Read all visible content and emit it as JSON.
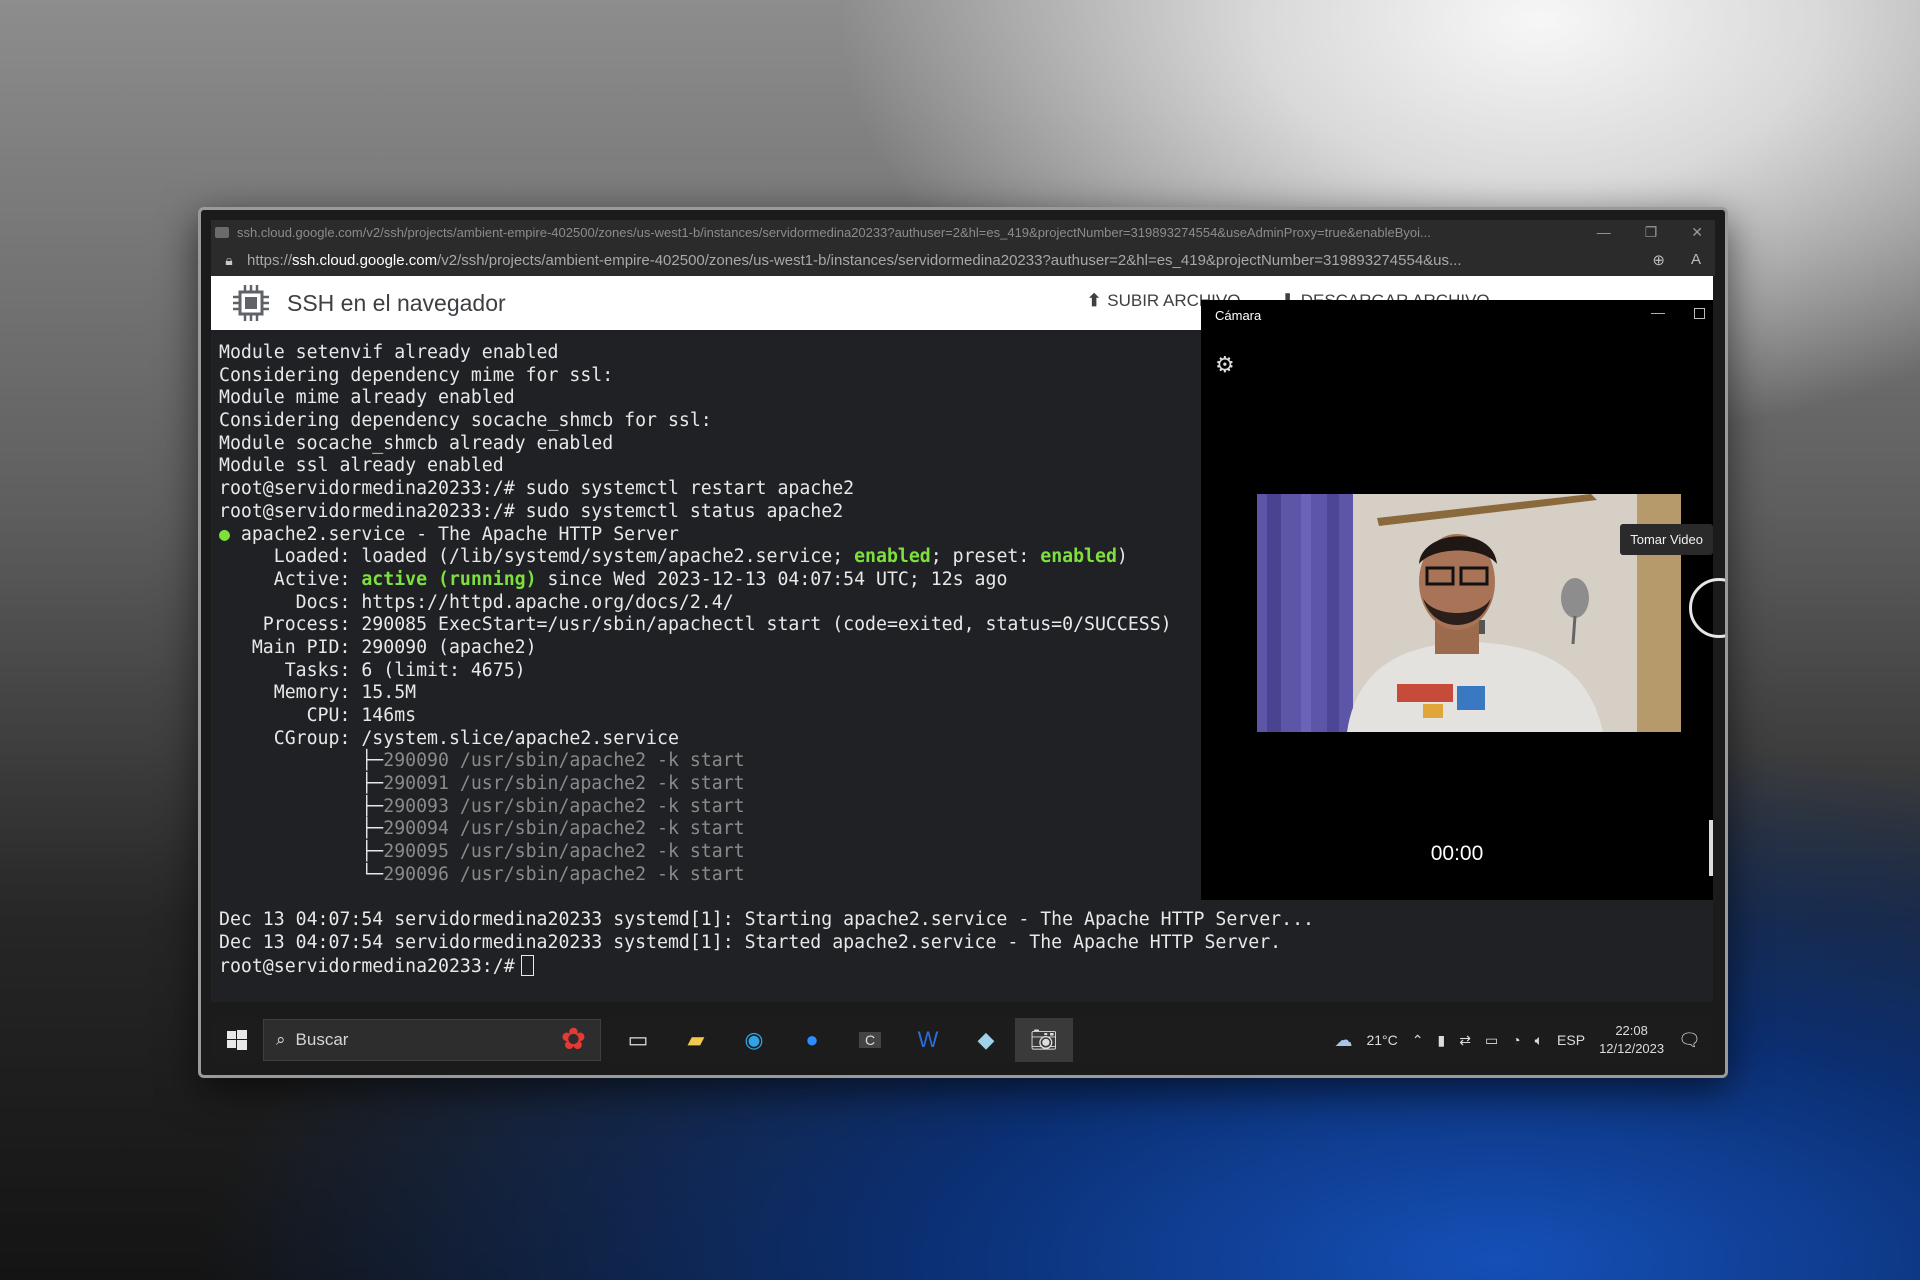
{
  "browser": {
    "title_url": "ssh.cloud.google.com/v2/ssh/projects/ambient-empire-402500/zones/us-west1-b/instances/servidormedina20233?authuser=2&hl=es_419&projectNumber=319893274554&useAdminProxy=true&enableByoi...",
    "url_prefix": "https://",
    "url_host": "ssh.cloud.google.com",
    "url_path": "/v2/ssh/projects/ambient-empire-402500/zones/us-west1-b/instances/servidormedina20233?authuser=2&hl=es_419&projectNumber=319893274554&us..."
  },
  "ssh": {
    "title": "SSH en el navegador",
    "upload_label": "SUBIR ARCHIVO",
    "download_label": "DESCARGAR ARCHIVO"
  },
  "terminal": {
    "l1": "Module setenvif already enabled",
    "l2": "Considering dependency mime for ssl:",
    "l3": "Module mime already enabled",
    "l4": "Considering dependency socache_shmcb for ssl:",
    "l5": "Module socache_shmcb already enabled",
    "l6": "Module ssl already enabled",
    "l7": "root@servidormedina20233:/# sudo systemctl restart apache2",
    "l8": "root@servidormedina20233:/# sudo systemctl status apache2",
    "bullet": "●",
    "l9": " apache2.service - The Apache HTTP Server",
    "loaded_pre": "     Loaded: loaded (/lib/systemd/system/apache2.service; ",
    "enabled1": "enabled",
    "loaded_mid": "; preset: ",
    "enabled2": "enabled",
    "loaded_post": ")",
    "active_pre": "     Active: ",
    "active_state": "active (running)",
    "active_post": " since Wed 2023-12-13 04:07:54 UTC; 12s ago",
    "docs": "       Docs: https://httpd.apache.org/docs/2.4/",
    "process": "    Process: 290085 ExecStart=/usr/sbin/apachectl start (code=exited, status=0/SUCCESS)",
    "mainpid": "   Main PID: 290090 (apache2)",
    "tasks": "      Tasks: 6 (limit: 4675)",
    "memory": "     Memory: 15.5M",
    "cpu": "        CPU: 146ms",
    "cgroup": "     CGroup: /system.slice/apache2.service",
    "tree_prefix_mid": "             ├─",
    "tree_prefix_last": "             └─",
    "t1": "290090 /usr/sbin/apache2 -k start",
    "t2": "290091 /usr/sbin/apache2 -k start",
    "t3": "290093 /usr/sbin/apache2 -k start",
    "t4": "290094 /usr/sbin/apache2 -k start",
    "t5": "290095 /usr/sbin/apache2 -k start",
    "t6": "290096 /usr/sbin/apache2 -k start",
    "log1": "Dec 13 04:07:54 servidormedina20233 systemd[1]: Starting apache2.service - The Apache HTTP Server...",
    "log2": "Dec 13 04:07:54 servidormedina20233 systemd[1]: Started apache2.service - The Apache HTTP Server.",
    "prompt": "root@servidormedina20233:/#"
  },
  "camera": {
    "title": "Cámara",
    "tooltip": "Tomar Video",
    "timer": "00:00"
  },
  "taskbar": {
    "search_placeholder": "Buscar",
    "weather": "21°C",
    "language": "ESP",
    "time": "22:08",
    "date": "12/12/2023"
  }
}
